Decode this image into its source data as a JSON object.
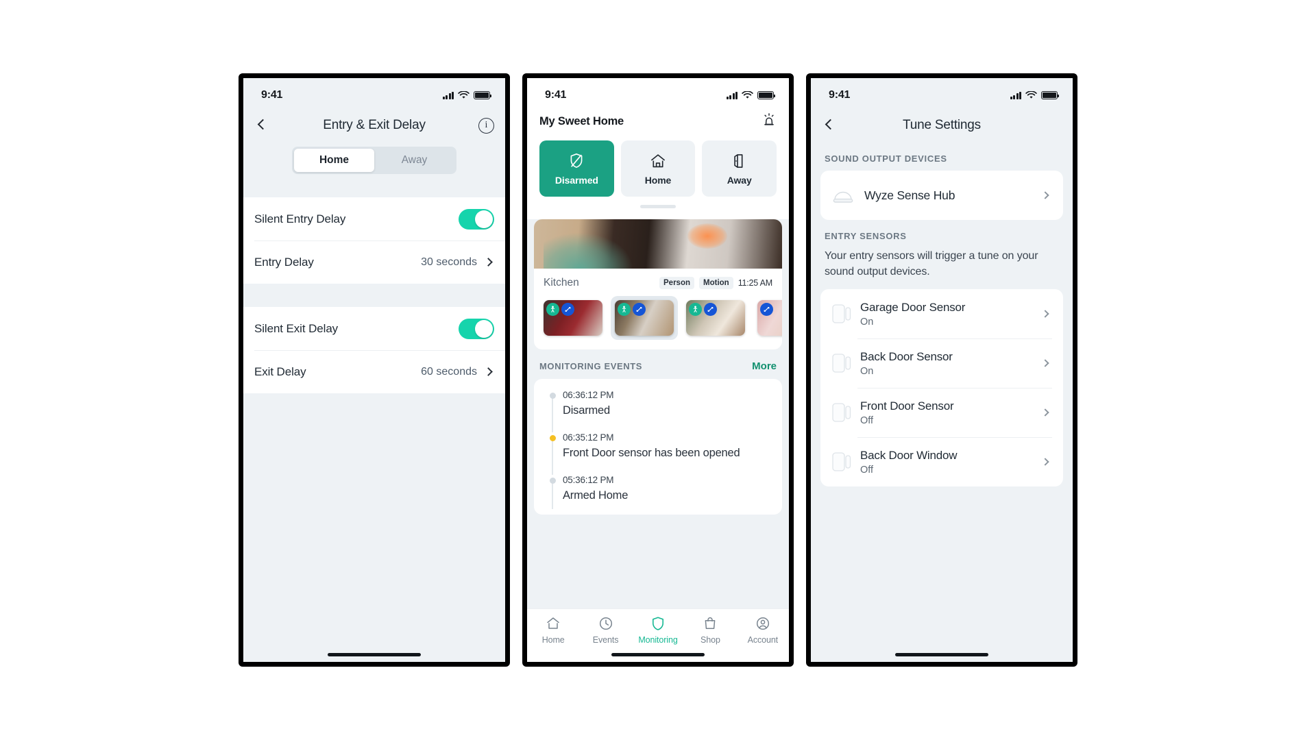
{
  "screen1": {
    "status": {
      "time": "9:41"
    },
    "nav": {
      "title": "Entry & Exit Delay",
      "back_icon": "chevron-left-icon",
      "info_icon": "info-circle-icon"
    },
    "segment": {
      "options": [
        "Home",
        "Away"
      ],
      "selected": "Home"
    },
    "rows": [
      {
        "label": "Silent Entry Delay",
        "type": "toggle",
        "value": "On"
      },
      {
        "label": "Entry Delay",
        "type": "value",
        "value": "30 seconds"
      },
      {
        "label": "Silent Exit Delay",
        "type": "toggle",
        "value": "On"
      },
      {
        "label": "Exit Delay",
        "type": "value",
        "value": "60 seconds"
      }
    ]
  },
  "screen2": {
    "status": {
      "time": "9:41"
    },
    "home_name": "My Sweet Home",
    "siren_icon": "siren-alarm-icon",
    "modes": [
      {
        "label": "Disarmed",
        "icon": "shield-slash-icon",
        "selected": true
      },
      {
        "label": "Home",
        "icon": "house-icon",
        "selected": false
      },
      {
        "label": "Away",
        "icon": "open-door-icon",
        "selected": false
      }
    ],
    "camera": {
      "name": "Kitchen",
      "tags": [
        "Person",
        "Motion"
      ],
      "time": "11:25 AM",
      "thumbnails": [
        {
          "badges": [
            "person",
            "motion"
          ],
          "selected": false
        },
        {
          "badges": [
            "person",
            "motion"
          ],
          "selected": true
        },
        {
          "badges": [
            "person",
            "motion"
          ],
          "selected": false
        },
        {
          "badges": [
            "motion"
          ],
          "selected": false
        }
      ]
    },
    "events": {
      "title": "MONITORING EVENTS",
      "more_label": "More",
      "items": [
        {
          "time": "06:36:12 PM",
          "text": "Disarmed",
          "state": "normal"
        },
        {
          "time": "06:35:12 PM",
          "text": "Front Door sensor has been opened",
          "state": "warn"
        },
        {
          "time": "05:36:12 PM",
          "text": "Armed Home",
          "state": "normal"
        }
      ]
    },
    "tabs": [
      {
        "label": "Home",
        "icon": "house-icon",
        "active": false
      },
      {
        "label": "Events",
        "icon": "clock-icon",
        "active": false
      },
      {
        "label": "Monitoring",
        "icon": "shield-icon",
        "active": true
      },
      {
        "label": "Shop",
        "icon": "shopping-bag-icon",
        "active": false
      },
      {
        "label": "Account",
        "icon": "user-circle-icon",
        "active": false
      }
    ]
  },
  "screen3": {
    "status": {
      "time": "9:41"
    },
    "nav": {
      "title": "Tune Settings",
      "back_icon": "chevron-left-icon"
    },
    "sound_section": {
      "header": "SOUND OUTPUT DEVICES",
      "device": "Wyze Sense Hub",
      "device_icon": "sense-hub-icon"
    },
    "entry_section": {
      "header": "ENTRY SENSORS",
      "description": "Your entry sensors will trigger a tune on your sound output devices.",
      "sensors": [
        {
          "name": "Garage Door Sensor",
          "state": "On"
        },
        {
          "name": "Back Door Sensor",
          "state": "On"
        },
        {
          "name": "Front Door Sensor",
          "state": "Off"
        },
        {
          "name": "Back Door Window",
          "state": "Off"
        }
      ]
    }
  },
  "colors": {
    "accent_teal": "#16b893",
    "mode_selected": "#1ba183",
    "more_link": "#12906f",
    "warn_dot": "#f5c023",
    "screen_bg": "#eef2f5"
  }
}
